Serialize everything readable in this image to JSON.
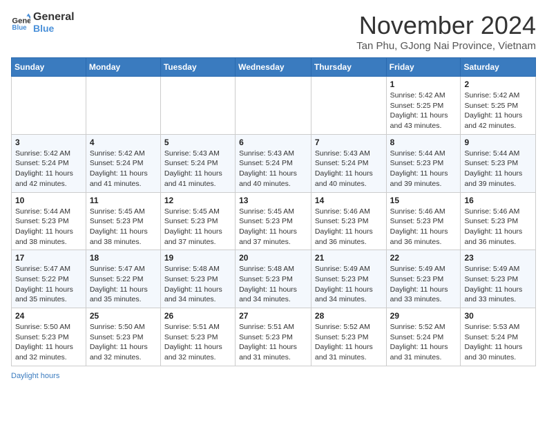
{
  "header": {
    "logo_line1": "General",
    "logo_line2": "Blue",
    "month_title": "November 2024",
    "location": "Tan Phu, GJong Nai Province, Vietnam"
  },
  "days_of_week": [
    "Sunday",
    "Monday",
    "Tuesday",
    "Wednesday",
    "Thursday",
    "Friday",
    "Saturday"
  ],
  "weeks": [
    [
      {
        "day": "",
        "info": ""
      },
      {
        "day": "",
        "info": ""
      },
      {
        "day": "",
        "info": ""
      },
      {
        "day": "",
        "info": ""
      },
      {
        "day": "",
        "info": ""
      },
      {
        "day": "1",
        "info": "Sunrise: 5:42 AM\nSunset: 5:25 PM\nDaylight: 11 hours\nand 43 minutes."
      },
      {
        "day": "2",
        "info": "Sunrise: 5:42 AM\nSunset: 5:25 PM\nDaylight: 11 hours\nand 42 minutes."
      }
    ],
    [
      {
        "day": "3",
        "info": "Sunrise: 5:42 AM\nSunset: 5:24 PM\nDaylight: 11 hours\nand 42 minutes."
      },
      {
        "day": "4",
        "info": "Sunrise: 5:42 AM\nSunset: 5:24 PM\nDaylight: 11 hours\nand 41 minutes."
      },
      {
        "day": "5",
        "info": "Sunrise: 5:43 AM\nSunset: 5:24 PM\nDaylight: 11 hours\nand 41 minutes."
      },
      {
        "day": "6",
        "info": "Sunrise: 5:43 AM\nSunset: 5:24 PM\nDaylight: 11 hours\nand 40 minutes."
      },
      {
        "day": "7",
        "info": "Sunrise: 5:43 AM\nSunset: 5:24 PM\nDaylight: 11 hours\nand 40 minutes."
      },
      {
        "day": "8",
        "info": "Sunrise: 5:44 AM\nSunset: 5:23 PM\nDaylight: 11 hours\nand 39 minutes."
      },
      {
        "day": "9",
        "info": "Sunrise: 5:44 AM\nSunset: 5:23 PM\nDaylight: 11 hours\nand 39 minutes."
      }
    ],
    [
      {
        "day": "10",
        "info": "Sunrise: 5:44 AM\nSunset: 5:23 PM\nDaylight: 11 hours\nand 38 minutes."
      },
      {
        "day": "11",
        "info": "Sunrise: 5:45 AM\nSunset: 5:23 PM\nDaylight: 11 hours\nand 38 minutes."
      },
      {
        "day": "12",
        "info": "Sunrise: 5:45 AM\nSunset: 5:23 PM\nDaylight: 11 hours\nand 37 minutes."
      },
      {
        "day": "13",
        "info": "Sunrise: 5:45 AM\nSunset: 5:23 PM\nDaylight: 11 hours\nand 37 minutes."
      },
      {
        "day": "14",
        "info": "Sunrise: 5:46 AM\nSunset: 5:23 PM\nDaylight: 11 hours\nand 36 minutes."
      },
      {
        "day": "15",
        "info": "Sunrise: 5:46 AM\nSunset: 5:23 PM\nDaylight: 11 hours\nand 36 minutes."
      },
      {
        "day": "16",
        "info": "Sunrise: 5:46 AM\nSunset: 5:23 PM\nDaylight: 11 hours\nand 36 minutes."
      }
    ],
    [
      {
        "day": "17",
        "info": "Sunrise: 5:47 AM\nSunset: 5:22 PM\nDaylight: 11 hours\nand 35 minutes."
      },
      {
        "day": "18",
        "info": "Sunrise: 5:47 AM\nSunset: 5:22 PM\nDaylight: 11 hours\nand 35 minutes."
      },
      {
        "day": "19",
        "info": "Sunrise: 5:48 AM\nSunset: 5:23 PM\nDaylight: 11 hours\nand 34 minutes."
      },
      {
        "day": "20",
        "info": "Sunrise: 5:48 AM\nSunset: 5:23 PM\nDaylight: 11 hours\nand 34 minutes."
      },
      {
        "day": "21",
        "info": "Sunrise: 5:49 AM\nSunset: 5:23 PM\nDaylight: 11 hours\nand 34 minutes."
      },
      {
        "day": "22",
        "info": "Sunrise: 5:49 AM\nSunset: 5:23 PM\nDaylight: 11 hours\nand 33 minutes."
      },
      {
        "day": "23",
        "info": "Sunrise: 5:49 AM\nSunset: 5:23 PM\nDaylight: 11 hours\nand 33 minutes."
      }
    ],
    [
      {
        "day": "24",
        "info": "Sunrise: 5:50 AM\nSunset: 5:23 PM\nDaylight: 11 hours\nand 32 minutes."
      },
      {
        "day": "25",
        "info": "Sunrise: 5:50 AM\nSunset: 5:23 PM\nDaylight: 11 hours\nand 32 minutes."
      },
      {
        "day": "26",
        "info": "Sunrise: 5:51 AM\nSunset: 5:23 PM\nDaylight: 11 hours\nand 32 minutes."
      },
      {
        "day": "27",
        "info": "Sunrise: 5:51 AM\nSunset: 5:23 PM\nDaylight: 11 hours\nand 31 minutes."
      },
      {
        "day": "28",
        "info": "Sunrise: 5:52 AM\nSunset: 5:23 PM\nDaylight: 11 hours\nand 31 minutes."
      },
      {
        "day": "29",
        "info": "Sunrise: 5:52 AM\nSunset: 5:24 PM\nDaylight: 11 hours\nand 31 minutes."
      },
      {
        "day": "30",
        "info": "Sunrise: 5:53 AM\nSunset: 5:24 PM\nDaylight: 11 hours\nand 30 minutes."
      }
    ]
  ],
  "footer": {
    "label": "Daylight hours"
  }
}
